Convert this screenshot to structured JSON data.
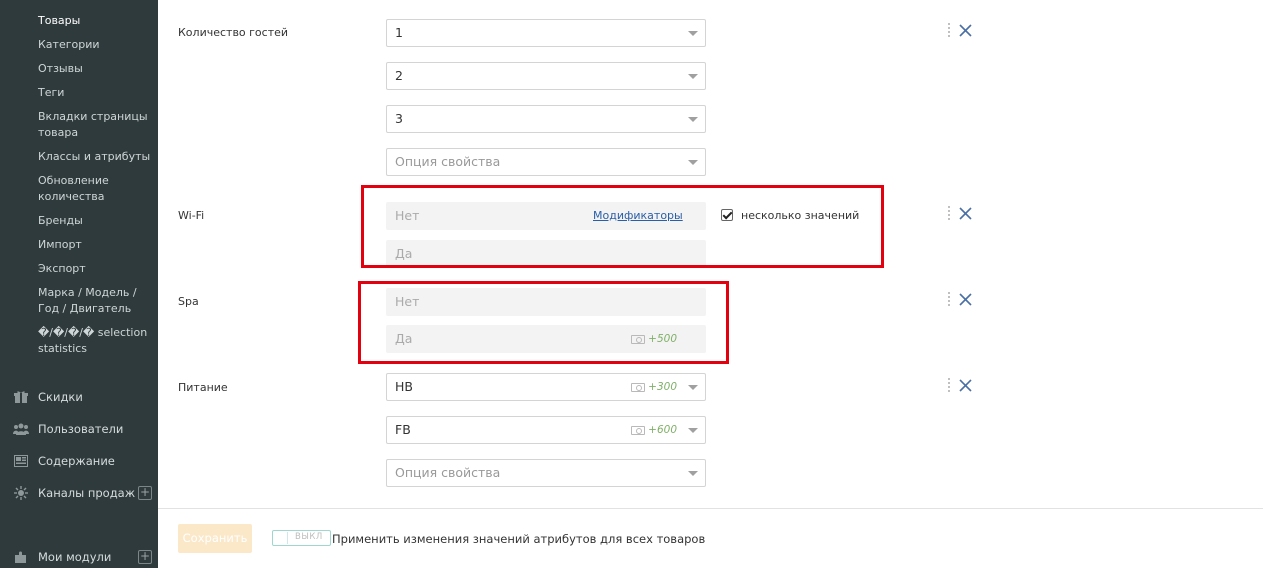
{
  "sidebar": {
    "sub_items": [
      {
        "label": "Товары",
        "active": true
      },
      {
        "label": "Категории"
      },
      {
        "label": "Отзывы"
      },
      {
        "label": "Теги"
      },
      {
        "label": "Вкладки страницы товара"
      },
      {
        "label": "Классы и атрибуты"
      },
      {
        "label": "Обновление количества"
      },
      {
        "label": "Бренды"
      },
      {
        "label": "Импорт"
      },
      {
        "label": "Экспорт"
      },
      {
        "label": "Марка / Модель / Год / Двигатель"
      },
      {
        "label": "�/�/�/� selection statistics"
      }
    ],
    "main_items": [
      {
        "label": "Скидки",
        "icon": "gift-icon"
      },
      {
        "label": "Пользователи",
        "icon": "users-icon"
      },
      {
        "label": "Содержание",
        "icon": "newspaper-icon"
      },
      {
        "label": "Каналы продаж",
        "icon": "sun-icon",
        "plus": true
      },
      {
        "label": "Мои модули",
        "icon": "puzzle-icon",
        "plus": true
      }
    ]
  },
  "attributes": {
    "guests": {
      "label": "Количество гостей",
      "values": [
        "1",
        "2",
        "3"
      ],
      "option_placeholder": "Опция свойства"
    },
    "wifi": {
      "label": "Wi-Fi",
      "values": [
        "Нет",
        "Да"
      ],
      "modifiers_link": "Модификаторы",
      "multiple_values_label": "несколько значений",
      "multiple_values_checked": true
    },
    "spa": {
      "label": "Spa",
      "values": [
        "Нет",
        "Да"
      ],
      "price_yes": "+500"
    },
    "food": {
      "label": "Питание",
      "values": [
        "HB",
        "FB"
      ],
      "prices": [
        "+300",
        "+600"
      ],
      "option_placeholder": "Опция свойства"
    }
  },
  "footer": {
    "save_label": "Сохранить",
    "toggle_label": "ВЫКЛ",
    "apply_label": "Применить изменения значений атрибутов для всех товаров"
  },
  "colors": {
    "sidebar_bg": "#2f3a3c",
    "highlight_red": "#e3000f",
    "price_green": "#7fb067",
    "link_blue": "#2a5ea8",
    "remove_blue": "#4a6fa5"
  }
}
